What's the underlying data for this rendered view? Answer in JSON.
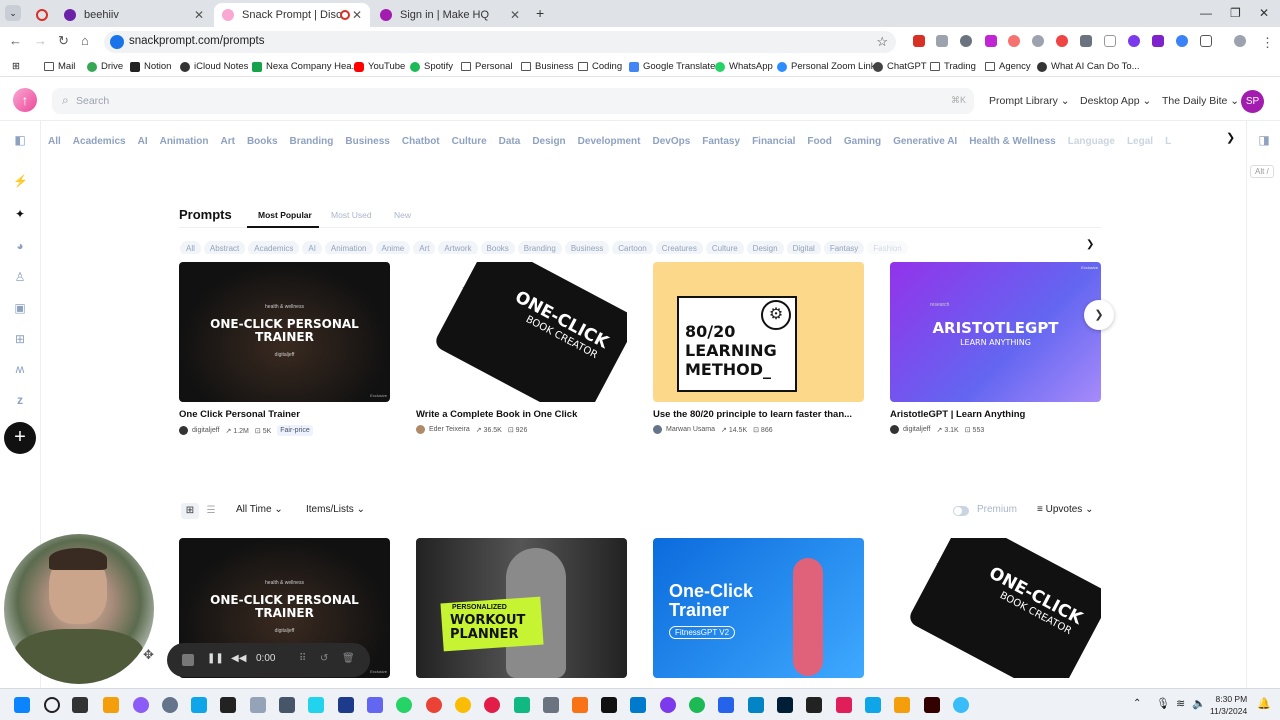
{
  "browser": {
    "tabs": [
      {
        "title": "",
        "active": false
      },
      {
        "title": "beehiiv",
        "active": false
      },
      {
        "title": "Snack Prompt | Discover Th",
        "active": true
      },
      {
        "title": "Sign in | Make HQ",
        "active": false
      }
    ],
    "url": "snackprompt.com/prompts",
    "bookmarks": [
      "Mail",
      "Drive",
      "Notion",
      "iCloud Notes",
      "Nexa Company Hea...",
      "YouTube",
      "Spotify",
      "Personal",
      "Business",
      "Coding",
      "Google Translate",
      "WhatsApp",
      "Personal Zoom Link",
      "ChatGPT",
      "Trading",
      "Agency",
      "What AI Can Do To..."
    ]
  },
  "header": {
    "search_placeholder": "Search",
    "search_shortcut": "⌘K",
    "nav": [
      "Prompt Library",
      "Desktop App",
      "The Daily Bite"
    ],
    "avatar": "SP"
  },
  "categories": [
    "All",
    "Academics",
    "AI",
    "Animation",
    "Art",
    "Books",
    "Branding",
    "Business",
    "Chatbot",
    "Culture",
    "Data",
    "Design",
    "Development",
    "DevOps",
    "Fantasy",
    "Financial",
    "Food",
    "Gaming",
    "Generative AI",
    "Health & Wellness",
    "Language",
    "Legal",
    "L"
  ],
  "right_bar": {
    "shortcut": "Alt /"
  },
  "prompts": {
    "title": "Prompts",
    "tabs": [
      "Most Popular",
      "Most Used",
      "New"
    ],
    "chips": [
      "All",
      "Abstract",
      "Academics",
      "AI",
      "Animation",
      "Anime",
      "Art",
      "Artwork",
      "Books",
      "Branding",
      "Business",
      "Cartoon",
      "Creatures",
      "Culture",
      "Design",
      "Digital",
      "Fantasy",
      "Fashion"
    ]
  },
  "featured": [
    {
      "title": "One Click Personal Trainer",
      "author": "digitaljeff",
      "views": "↗ 1.2M",
      "saves": "⊡ 5K",
      "badge": "Fair-price",
      "thumb_tag": "health & wellness",
      "thumb_text": "ONE-CLICK PERSONAL TRAINER",
      "thumb_sub": "digitaljeff",
      "thumb_corner": "Exclusive"
    },
    {
      "title": "Write a Complete Book in One Click",
      "author": "Eder Teixeira",
      "views": "↗ 36.5K",
      "saves": "⊡ 926",
      "thumb_text": "ONE-CLICK",
      "thumb_sub": "BOOK CREATOR"
    },
    {
      "title": "Use the 80/20 principle to learn faster than...",
      "author": "Marwan Usama",
      "views": "↗ 14.5K",
      "saves": "⊡ 866",
      "thumb_text": "80/20 LEARNING METHOD_"
    },
    {
      "title": "AristotleGPT | Learn Anything",
      "author": "digitaljeff",
      "views": "↗ 3.1K",
      "saves": "⊡ 553",
      "thumb_tag": "research",
      "thumb_text": "ARISTOTLEGPT",
      "thumb_sub": "LEARN ANYTHING",
      "thumb_corner": "Exclusive"
    }
  ],
  "filters": {
    "time": "All Time",
    "type": "Items/Lists",
    "premium": "Premium",
    "sort": "Upvotes"
  },
  "grid": [
    {
      "thumb_tag": "health & wellness",
      "thumb_text": "ONE-CLICK PERSONAL TRAINER",
      "thumb_sub": "digitaljeff",
      "thumb_corner": "Exclusive"
    },
    {
      "thumb_text": "WORKOUT PLANNER",
      "thumb_sub": "PERSONALIZED"
    },
    {
      "thumb_text": "One-Click Trainer",
      "thumb_sub": "FitnessGPT V2"
    },
    {
      "thumb_text": "ONE-CLICK",
      "thumb_sub": "BOOK CREATOR"
    }
  ],
  "recorder": {
    "time": "0:00"
  },
  "taskbar": {
    "time": "8:30 PM",
    "date": "11/3/2024"
  },
  "colors": {
    "accent": "#ec4899",
    "muted": "#8ea2c0"
  }
}
